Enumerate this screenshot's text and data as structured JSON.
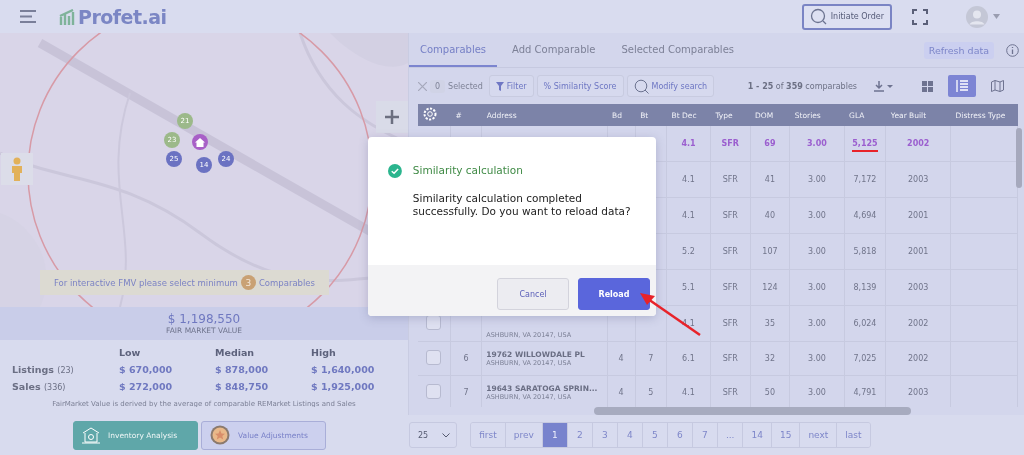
{
  "header": {
    "logo": "Profet.ai",
    "initiate_order": "Initiate Order"
  },
  "map": {
    "markers": [
      {
        "label": "21",
        "kind": "listing"
      },
      {
        "label": "23",
        "kind": "listing"
      },
      {
        "label": "25",
        "kind": "comparable"
      },
      {
        "label": "14",
        "kind": "comparable"
      },
      {
        "label": "24",
        "kind": "comparable"
      },
      {
        "kind": "home"
      }
    ],
    "notice": {
      "before": "For interactive FMV please select minimum",
      "count": "3",
      "after": "Comparables"
    }
  },
  "fmv": {
    "value": "$ 1,198,550",
    "label": "FAIR MARKET VALUE"
  },
  "stats": {
    "columns": [
      "Low",
      "Median",
      "High"
    ],
    "rows": [
      {
        "name": "Listings",
        "count": "(23)",
        "values": [
          "$ 670,000",
          "$ 878,000",
          "$ 1,640,000"
        ]
      },
      {
        "name": "Sales",
        "count": "(336)",
        "values": [
          "$ 272,000",
          "$ 848,750",
          "$ 1,925,000"
        ]
      }
    ],
    "footnote": "FairMarket Value is derived by the average of comparable REMarket Listings and Sales"
  },
  "left_buttons": [
    {
      "label": "Inventory Analysis",
      "selected": true
    },
    {
      "label": "Value Adjustments",
      "selected": false
    }
  ],
  "tabs": [
    {
      "label": "Comparables",
      "selected": true
    },
    {
      "label": "Add Comparable",
      "selected": false
    },
    {
      "label": "Selected Comparables",
      "selected": false
    }
  ],
  "refresh": "Refresh data",
  "toolbar": {
    "selected_count": "0",
    "selected_label": "Selected",
    "filter": "Filter",
    "similarity": "% Similarity Score",
    "modify": "Modify search",
    "range": "1 - 25",
    "of": "of",
    "total": "359",
    "unit": "comparables"
  },
  "view_modes": [
    {
      "kind": "grid",
      "selected": false
    },
    {
      "kind": "list",
      "selected": true
    },
    {
      "kind": "map",
      "selected": false
    }
  ],
  "table": {
    "columns": [
      "#",
      "Address",
      "Bd",
      "Bt",
      "Bt Dec",
      "Type",
      "DOM",
      "Stories",
      "GLA",
      "Year Built",
      "Distress Type"
    ],
    "rows": [
      {
        "highlighted": true,
        "dec": "4.1",
        "type": "SFR",
        "dom": "69",
        "stories": "3.00",
        "gla": "5,125",
        "year": "2002"
      },
      {
        "highlighted": false,
        "dec": "4.1",
        "type": "SFR",
        "dom": "41",
        "stories": "3.00",
        "gla": "7,172",
        "year": "2003"
      },
      {
        "highlighted": false,
        "dec": "4.1",
        "type": "SFR",
        "dom": "40",
        "stories": "3.00",
        "gla": "4,694",
        "year": "2001"
      },
      {
        "highlighted": false,
        "dec": "5.2",
        "type": "SFR",
        "dom": "107",
        "stories": "3.00",
        "gla": "5,818",
        "year": "2001"
      },
      {
        "highlighted": false,
        "dec": "5.1",
        "type": "SFR",
        "dom": "124",
        "stories": "3.00",
        "gla": "8,139",
        "year": "2003"
      },
      {
        "highlighted": false,
        "checked": false,
        "addr2": "ASHBURN, VA 20147, USA",
        "dec": "4.1",
        "type": "SFR",
        "dom": "35",
        "stories": "3.00",
        "gla": "6,024",
        "year": "2002"
      },
      {
        "highlighted": false,
        "checked": false,
        "num": "6",
        "addr1": "19762 WILLOWDALE PL",
        "addr2": "ASHBURN, VA 20147, USA",
        "bd": "4",
        "bt": "7",
        "dec": "6.1",
        "type": "SFR",
        "dom": "32",
        "stories": "3.00",
        "gla": "7,025",
        "year": "2002"
      },
      {
        "highlighted": false,
        "checked": false,
        "num": "7",
        "addr1": "19643 SARATOGA SPRIN...",
        "addr2": "ASHBURN, VA 20147, USA",
        "bd": "4",
        "bt": "5",
        "dec": "4.1",
        "type": "SFR",
        "dom": "50",
        "stories": "3.00",
        "gla": "4,791",
        "year": "2003"
      }
    ]
  },
  "pagination": {
    "page_size": "25",
    "pages": [
      {
        "label": "first",
        "selected": false
      },
      {
        "label": "prev",
        "selected": false
      },
      {
        "label": "1",
        "selected": true
      },
      {
        "label": "2",
        "selected": false
      },
      {
        "label": "3",
        "selected": false
      },
      {
        "label": "4",
        "selected": false
      },
      {
        "label": "5",
        "selected": false
      },
      {
        "label": "6",
        "selected": false
      },
      {
        "label": "7",
        "selected": false
      },
      {
        "label": "...",
        "selected": false
      },
      {
        "label": "14",
        "selected": false
      },
      {
        "label": "15",
        "selected": false
      },
      {
        "label": "next",
        "selected": false
      },
      {
        "label": "last",
        "selected": false
      }
    ]
  },
  "dialog": {
    "title": "Similarity calculation",
    "message": "Similarity calculation completed successfully. Do you want to reload data?",
    "buttons": [
      {
        "label": "Cancel",
        "kind": "secondary"
      },
      {
        "label": "Reload",
        "kind": "primary"
      }
    ]
  }
}
